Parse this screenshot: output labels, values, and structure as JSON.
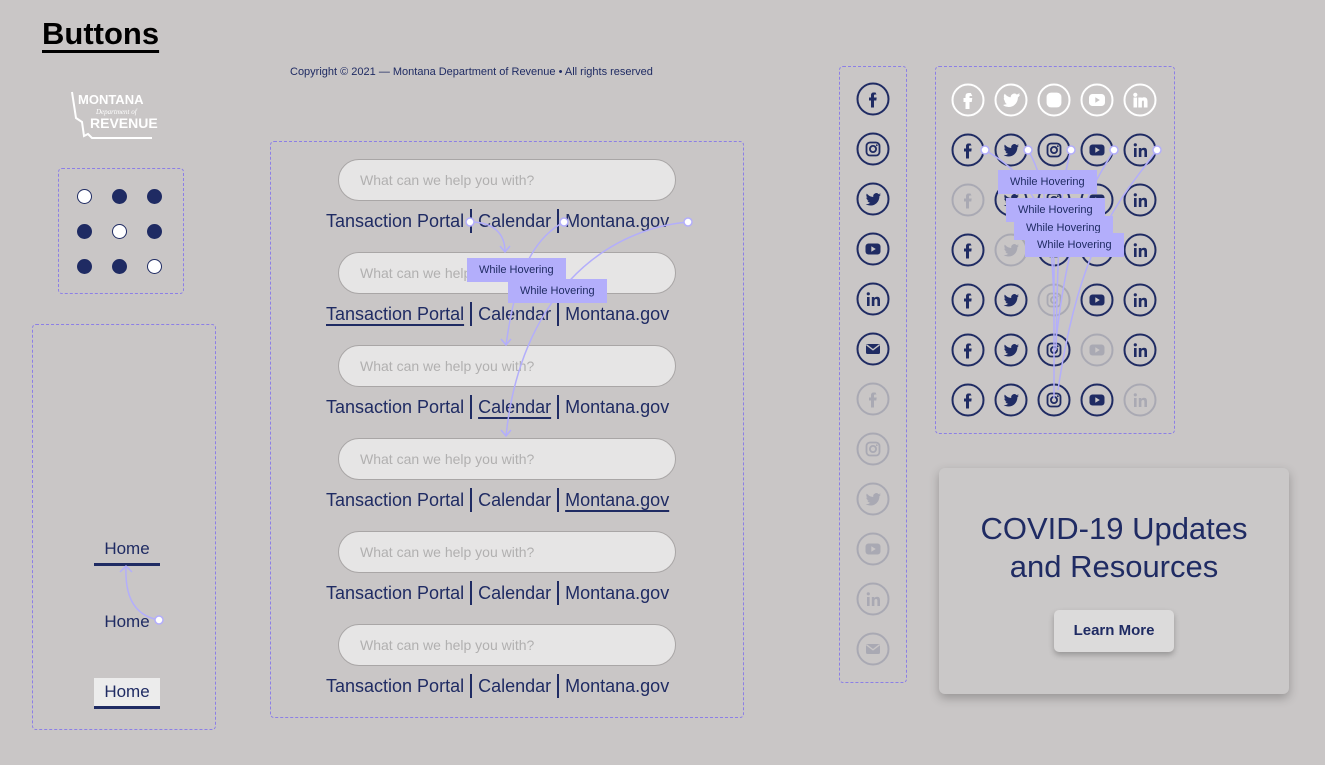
{
  "page": {
    "title": "Buttons"
  },
  "footer": {
    "copyright": "Copyright © 2021 — Montana Department of Revenue • All rights reserved"
  },
  "logo": {
    "line1": "MONTANA",
    "line2": "Department of",
    "line3": "REVENUE"
  },
  "dots": {
    "states": [
      "hollow",
      "filled",
      "filled",
      "filled",
      "hollow",
      "filled",
      "filled",
      "filled",
      "hollow"
    ]
  },
  "home_buttons": {
    "label": "Home",
    "variants": [
      "underline",
      "plain",
      "boxed"
    ]
  },
  "search_rows": [
    {
      "placeholder": "What can we help you with?",
      "links": [
        "Tansaction Portal",
        "Calendar",
        "Montana.gov"
      ],
      "active": -1
    },
    {
      "placeholder": "What can we help you with?",
      "links": [
        "Tansaction Portal",
        "Calendar",
        "Montana.gov"
      ],
      "active": 0
    },
    {
      "placeholder": "What can we help you with?",
      "links": [
        "Tansaction Portal",
        "Calendar",
        "Montana.gov"
      ],
      "active": 1
    },
    {
      "placeholder": "What can we help you with?",
      "links": [
        "Tansaction Portal",
        "Calendar",
        "Montana.gov"
      ],
      "active": 2
    },
    {
      "placeholder": "What can we help you with?",
      "links": [
        "Tansaction Portal",
        "Calendar",
        "Montana.gov"
      ],
      "active": -1
    },
    {
      "placeholder": "What can we help you with?",
      "links": [
        "Tansaction Portal",
        "Calendar",
        "Montana.gov"
      ],
      "active": -1
    }
  ],
  "social_column": [
    {
      "icon": "facebook-icon",
      "state": "normal"
    },
    {
      "icon": "instagram-icon",
      "state": "normal"
    },
    {
      "icon": "twitter-icon",
      "state": "normal"
    },
    {
      "icon": "youtube-icon",
      "state": "normal"
    },
    {
      "icon": "linkedin-icon",
      "state": "normal"
    },
    {
      "icon": "email-icon",
      "state": "normal"
    },
    {
      "icon": "facebook-icon",
      "state": "faded"
    },
    {
      "icon": "instagram-icon",
      "state": "faded"
    },
    {
      "icon": "twitter-icon",
      "state": "faded"
    },
    {
      "icon": "youtube-icon",
      "state": "faded"
    },
    {
      "icon": "linkedin-icon",
      "state": "faded"
    },
    {
      "icon": "email-icon",
      "state": "faded"
    }
  ],
  "social_grid": {
    "columns": [
      "facebook-icon",
      "twitter-icon",
      "instagram-icon",
      "youtube-icon",
      "linkedin-icon"
    ],
    "rows": [
      [
        "white",
        "white",
        "white",
        "white",
        "white"
      ],
      [
        "normal",
        "normal",
        "normal",
        "normal",
        "normal"
      ],
      [
        "faded",
        "normal",
        "normal",
        "normal",
        "normal"
      ],
      [
        "normal",
        "faded",
        "normal",
        "normal",
        "normal"
      ],
      [
        "normal",
        "normal",
        "faded",
        "normal",
        "normal"
      ],
      [
        "normal",
        "normal",
        "normal",
        "faded",
        "normal"
      ],
      [
        "normal",
        "normal",
        "normal",
        "normal",
        "faded"
      ]
    ]
  },
  "tooltips": {
    "label": "While Hovering"
  },
  "covid_card": {
    "title_line1": "COVID-19 Updates",
    "title_line2": "and Resources",
    "button_label": "Learn More"
  },
  "colors": {
    "navy": "#1f2b63",
    "background": "#c9c6c6",
    "accent": "#8c7fe6",
    "tooltip": "#b3aefb"
  }
}
